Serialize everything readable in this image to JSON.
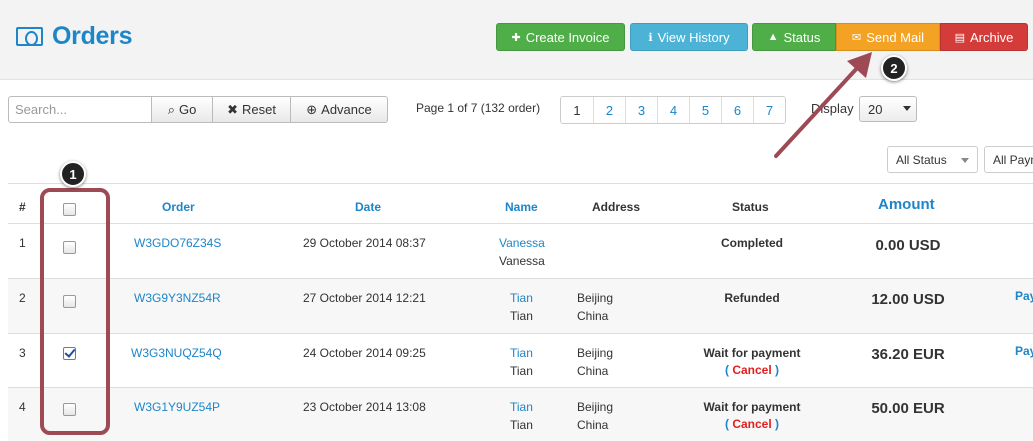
{
  "header": {
    "title": "Orders",
    "buttons": {
      "create_invoice": "Create Invoice",
      "view_history": "View History",
      "status": "Status",
      "send_mail": "Send Mail",
      "archive": "Archive"
    }
  },
  "search": {
    "placeholder": "Search...",
    "go": "Go",
    "reset": "Reset",
    "advance": "Advance"
  },
  "pagination": {
    "info": "Page 1 of 7 (132 order)",
    "pages": [
      "1",
      "2",
      "3",
      "4",
      "5",
      "6",
      "7"
    ]
  },
  "display": {
    "label": "Display",
    "value": "20"
  },
  "filters": {
    "status": "All Status",
    "payment": "All Payment"
  },
  "table": {
    "headers": {
      "num": "#",
      "order": "Order",
      "date": "Date",
      "name": "Name",
      "address": "Address",
      "status": "Status",
      "amount": "Amount"
    },
    "rows": [
      {
        "num": "1",
        "checked": false,
        "order": "W3GDO76Z34S",
        "date": "29 October 2014 08:37",
        "name1": "Vanessa",
        "name2": "Vanessa",
        "addr1": "",
        "addr2": "",
        "status": "Completed",
        "cancel": "",
        "amount": "0.00 USD",
        "pay": ""
      },
      {
        "num": "2",
        "checked": false,
        "order": "W3G9Y3NZ54R",
        "date": "27 October 2014 12:21",
        "name1": "Tian",
        "name2": "Tian",
        "addr1": "Beijing",
        "addr2": "China",
        "status": "Refunded",
        "cancel": "",
        "amount": "12.00 USD",
        "pay": "Pay"
      },
      {
        "num": "3",
        "checked": true,
        "order": "W3G3NUQZ54Q",
        "date": "24 October 2014 09:25",
        "name1": "Tian",
        "name2": "Tian",
        "addr1": "Beijing",
        "addr2": "China",
        "status": "Wait for payment",
        "cancel": "Cancel",
        "amount": "36.20 EUR",
        "pay": "Pay"
      },
      {
        "num": "4",
        "checked": false,
        "order": "W3G1Y9UZ54P",
        "date": "23 October 2014 13:08",
        "name1": "Tian",
        "name2": "Tian",
        "addr1": "Beijing",
        "addr2": "China",
        "status": "Wait for payment",
        "cancel": "Cancel",
        "amount": "50.00 EUR",
        "pay": ""
      }
    ]
  },
  "callouts": [
    "1",
    "2"
  ],
  "colors": {
    "brand_blue": "#1d86c8",
    "green": "#4fae48",
    "cyan": "#4cb3d7",
    "orange": "#f4a223",
    "red": "#d43c3a",
    "highlight": "#9e4a55"
  },
  "icons": {
    "header": "money-icon",
    "create_invoice": "plus-icon",
    "view_history": "info-icon",
    "status": "warning-icon",
    "send_mail": "envelope-icon",
    "archive": "archive-icon",
    "go": "search-icon",
    "reset": "close-icon",
    "advance": "zoom-icon"
  }
}
